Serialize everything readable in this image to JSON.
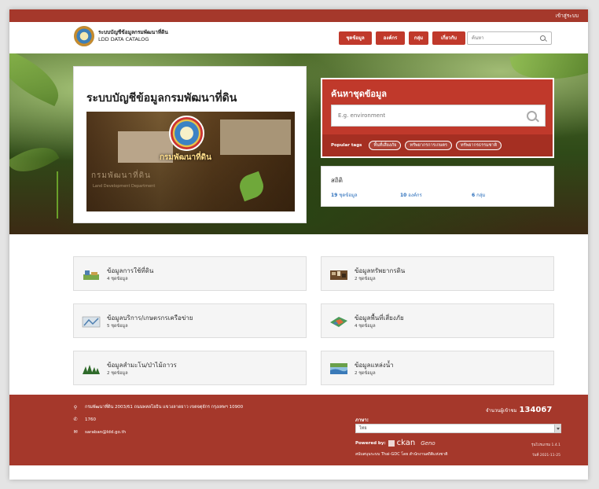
{
  "topbar": {
    "login": "เข้าสู่ระบบ"
  },
  "header": {
    "title_th": "ระบบบัญชีข้อมูลกรมพัฒนาที่ดิน",
    "title_en": "LDD DATA CATALOG",
    "nav": [
      "ชุดข้อมูล",
      "องค์กร",
      "กลุ่ม",
      "เกี่ยวกับ"
    ],
    "search_placeholder": "ค้นหา"
  },
  "hero": {
    "title": "ระบบบัญชีข้อมูลกรมพัฒนาที่ดิน",
    "photo_caption": "กรมพัฒนาที่ดิน",
    "photo_sign": "กรมพัฒนาที่ดิน",
    "photo_sign_en": "Land Development Department"
  },
  "search": {
    "heading": "ค้นหาชุดข้อมูล",
    "placeholder": "E.g. environment",
    "popular_label": "Popular tags",
    "tags": [
      "พื้นที่เสี่ยงภัย",
      "ทรัพยากรการเกษตร",
      "ทรัพยากรธรรมชาติ"
    ]
  },
  "stats": {
    "heading": "สถิติ",
    "datasets": "19",
    "datasets_label": "ชุดข้อมูล",
    "orgs": "10",
    "orgs_label": "องค์กร",
    "groups": "6",
    "groups_label": "กลุ่ม"
  },
  "categories": [
    {
      "name": "ข้อมูลการใช้ที่ดิน",
      "count": "4 ชุดข้อมูล"
    },
    {
      "name": "ข้อมูลทรัพยากรดิน",
      "count": "2 ชุดข้อมูล"
    },
    {
      "name": "ข้อมูลบริการ/เกษตรกรเครือข่าย",
      "count": "5 ชุดข้อมูล"
    },
    {
      "name": "ข้อมูลพื้นที่เสี่ยงภัย",
      "count": "4 ชุดข้อมูล"
    },
    {
      "name": "ข้อมูลสำมะโน/ป่าไม้ถาวร",
      "count": "2 ชุดข้อมูล"
    },
    {
      "name": "ข้อมูลแหล่งน้ำ",
      "count": "2 ชุดข้อมูล"
    }
  ],
  "footer": {
    "address": "กรมพัฒนาที่ดิน 2003/61 ถนนพหลโยธิน แขวงลาดยาว เขตจตุจักร กรุงเทพฯ 10900",
    "phone": "1760",
    "email": "saraban@ldd.go.th",
    "visitors_label": "จำนวนผู้เข้าชม",
    "visitors": "134067",
    "lang_label": "ภาษา:",
    "lang_value": "ไทย",
    "powered_by": "Powered by:",
    "ckan": "ckan",
    "geno": "Geno",
    "support": "สนับสนุนระบบ Thai-GDC โดย สำนักงานสถิติแห่งชาติ",
    "version": "รุ่นโปรแกรม 1.4.1",
    "date": "วันที่ 2021-11-25"
  },
  "colors": {
    "brand": "#c0392b",
    "brand_dark": "#a5382b",
    "link": "#2a6ebb"
  }
}
